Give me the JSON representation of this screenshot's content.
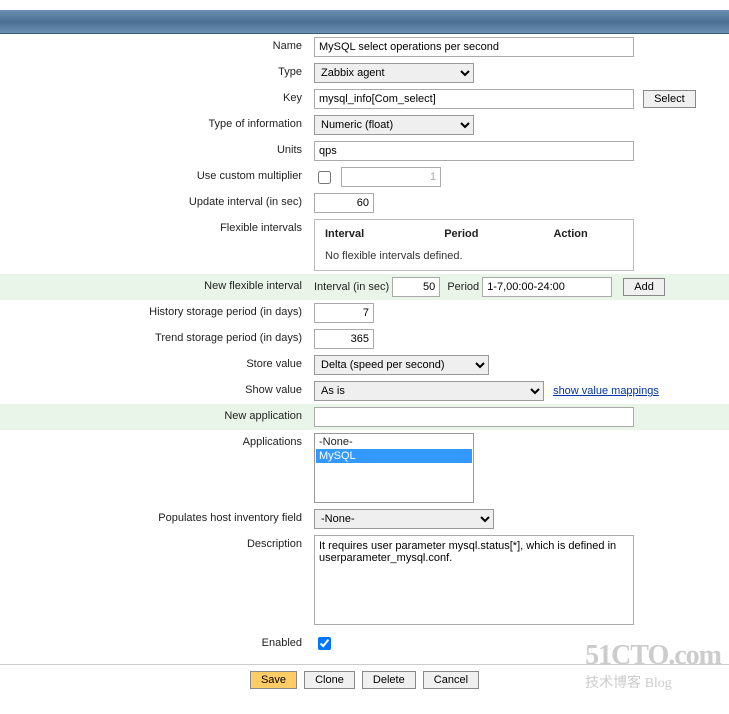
{
  "labels": {
    "name": "Name",
    "type": "Type",
    "key": "Key",
    "type_of_info": "Type of information",
    "units": "Units",
    "use_multiplier": "Use custom multiplier",
    "update_interval": "Update interval (in sec)",
    "flexible_intervals": "Flexible intervals",
    "new_flex_interval": "New flexible interval",
    "history_period": "History storage period (in days)",
    "trend_period": "Trend storage period (in days)",
    "store_value": "Store value",
    "show_value": "Show value",
    "new_application": "New application",
    "applications": "Applications",
    "populates_host": "Populates host inventory field",
    "description": "Description",
    "enabled": "Enabled"
  },
  "values": {
    "name": "MySQL select operations per second",
    "type": "Zabbix agent",
    "key": "mysql_info[Com_select]",
    "type_of_info": "Numeric (float)",
    "units": "qps",
    "multiplier_value": "1",
    "update_interval": "60",
    "new_flex_interval_sec": "50",
    "new_flex_period": "1-7,00:00-24:00",
    "history_period": "7",
    "trend_period": "365",
    "store_value": "Delta (speed per second)",
    "show_value": "As is",
    "new_application": "",
    "populates_host": "-None-",
    "description": "It requires user parameter mysql.status[*], which is defined in userparameter_mysql.conf."
  },
  "flex_table": {
    "col_interval": "Interval",
    "col_period": "Period",
    "col_action": "Action",
    "empty_msg": "No flexible intervals defined."
  },
  "new_flex_labels": {
    "interval": "Interval (in sec)",
    "period": "Period"
  },
  "buttons": {
    "select": "Select",
    "add": "Add",
    "save": "Save",
    "clone": "Clone",
    "delete": "Delete",
    "cancel": "Cancel"
  },
  "links": {
    "show_value_mappings": "show value mappings"
  },
  "applications": {
    "options": [
      "-None-",
      "MySQL"
    ],
    "selected": "MySQL"
  },
  "watermark": {
    "big": "51CTO.com",
    "small": "技术博客 Blog"
  }
}
